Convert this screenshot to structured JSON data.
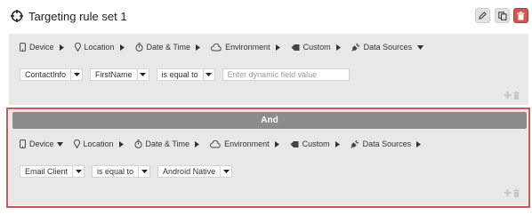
{
  "header": {
    "title": "Targeting rule set 1",
    "icons": [
      "crosshair-icon",
      "pencil-icon",
      "copy-icon",
      "trash-icon"
    ]
  },
  "rule1": {
    "categories": [
      {
        "label": "Device",
        "icon": "mobile-icon",
        "arrow": "right"
      },
      {
        "label": "Location",
        "icon": "map-pin-icon",
        "arrow": "right"
      },
      {
        "label": "Date & Time",
        "icon": "stopwatch-icon",
        "arrow": "right"
      },
      {
        "label": "Environment",
        "icon": "cloud-icon",
        "arrow": "right"
      },
      {
        "label": "Custom",
        "icon": "tag-icon",
        "arrow": "right"
      },
      {
        "label": "Data Sources",
        "icon": "plug-icon",
        "arrow": "down"
      }
    ],
    "field": "ContactInfo",
    "subfield": "FirstName",
    "operator": "is equal to",
    "value_placeholder": "Enter dynamic field value"
  },
  "and_label": "And",
  "rule2": {
    "categories": [
      {
        "label": "Device",
        "icon": "mobile-icon",
        "arrow": "down"
      },
      {
        "label": "Location",
        "icon": "map-pin-icon",
        "arrow": "right"
      },
      {
        "label": "Date & Time",
        "icon": "stopwatch-icon",
        "arrow": "right"
      },
      {
        "label": "Environment",
        "icon": "cloud-icon",
        "arrow": "right"
      },
      {
        "label": "Custom",
        "icon": "tag-icon",
        "arrow": "right"
      },
      {
        "label": "Data Sources",
        "icon": "plug-icon",
        "arrow": "right"
      }
    ],
    "field": "Email Client",
    "operator": "is equal to",
    "value": "Android Native"
  },
  "colors": {
    "panel": "#e8e8e8",
    "and_bar": "#8c8c8c",
    "highlight": "#d9534f",
    "delete": "#d9534f"
  }
}
